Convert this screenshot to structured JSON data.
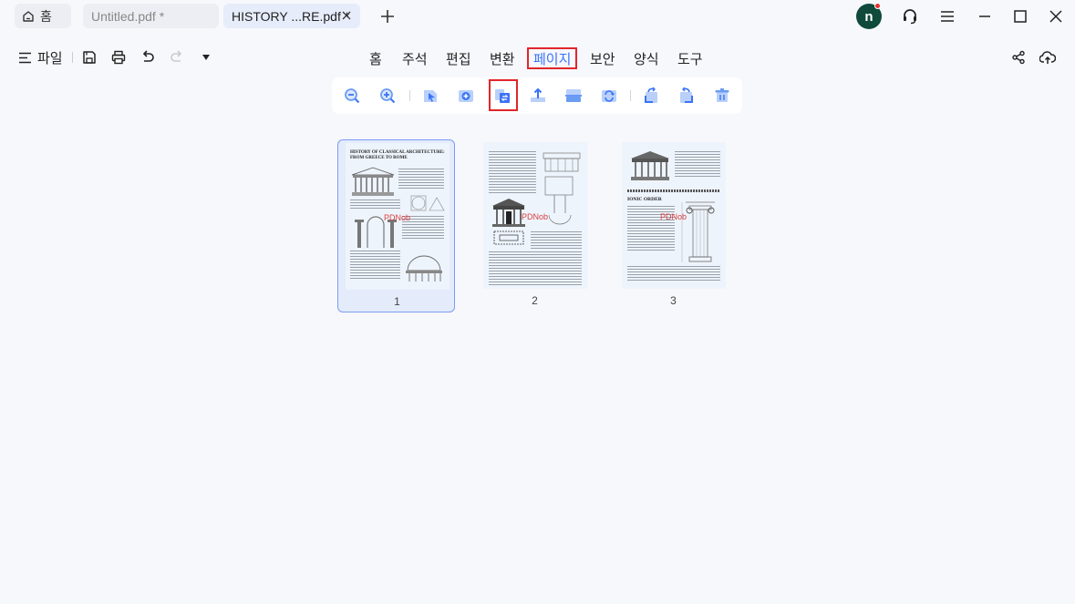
{
  "titlebar": {
    "home_tab": "홈",
    "tabs": [
      {
        "label": "Untitled.pdf *"
      },
      {
        "label": "HISTORY ...RE.pdf *"
      }
    ],
    "avatar_letter": "n"
  },
  "menubar": {
    "file_label": "파일",
    "tabs": [
      "홈",
      "주석",
      "편집",
      "변환",
      "페이지",
      "보안",
      "양식",
      "도구"
    ],
    "active_tab": "페이지"
  },
  "toolbar": {
    "icons": [
      "zoom-out-icon",
      "zoom-in-icon",
      "extract-page-icon",
      "insert-page-icon",
      "replace-page-icon",
      "export-page-icon",
      "split-page-icon",
      "reverse-page-icon",
      "rotate-left-icon",
      "rotate-right-icon",
      "delete-page-icon"
    ],
    "highlighted": "replace-page-icon"
  },
  "pages": [
    {
      "number": "1",
      "selected": true,
      "title": "HISTORY OF CLASSICAL ARCHITECTURE: FROM GREECE TO ROME",
      "watermark": "PDNob"
    },
    {
      "number": "2",
      "selected": false,
      "watermark": "PDNob"
    },
    {
      "number": "3",
      "selected": false,
      "heading": "IONIC ORDER",
      "watermark": "PDNob"
    }
  ],
  "colors": {
    "accent": "#3b74f5",
    "highlight_box": "#e0262b",
    "avatar_bg": "#0f4a3c",
    "toolbar_icon": "#6b9cf3"
  }
}
